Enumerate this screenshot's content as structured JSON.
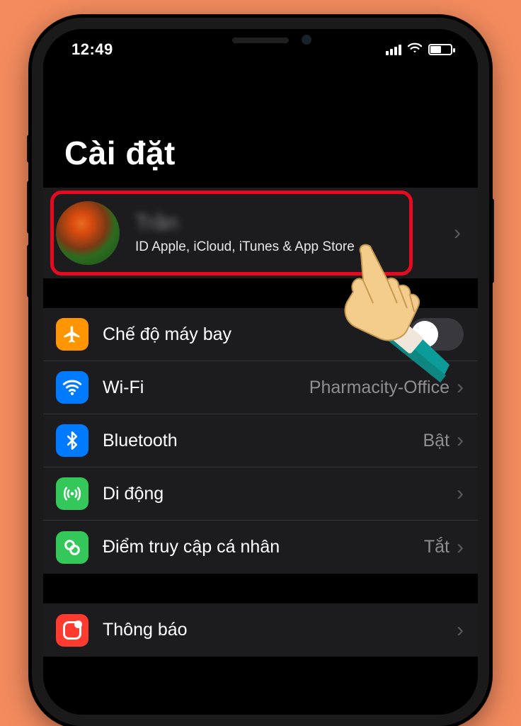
{
  "status_bar": {
    "time": "12:49"
  },
  "page": {
    "title": "Cài đặt"
  },
  "profile": {
    "name": "Trần",
    "subtitle": "ID Apple, iCloud, iTunes & App Store"
  },
  "rows": {
    "airplane": {
      "label": "Chế độ máy bay",
      "value": "",
      "on": false
    },
    "wifi": {
      "label": "Wi-Fi",
      "value": "Pharmacity-Office"
    },
    "bluetooth": {
      "label": "Bluetooth",
      "value": "Bật"
    },
    "cellular": {
      "label": "Di động",
      "value": ""
    },
    "hotspot": {
      "label": "Điểm truy cập cá nhân",
      "value": "Tắt"
    },
    "notifications": {
      "label": "Thông báo",
      "value": ""
    }
  }
}
